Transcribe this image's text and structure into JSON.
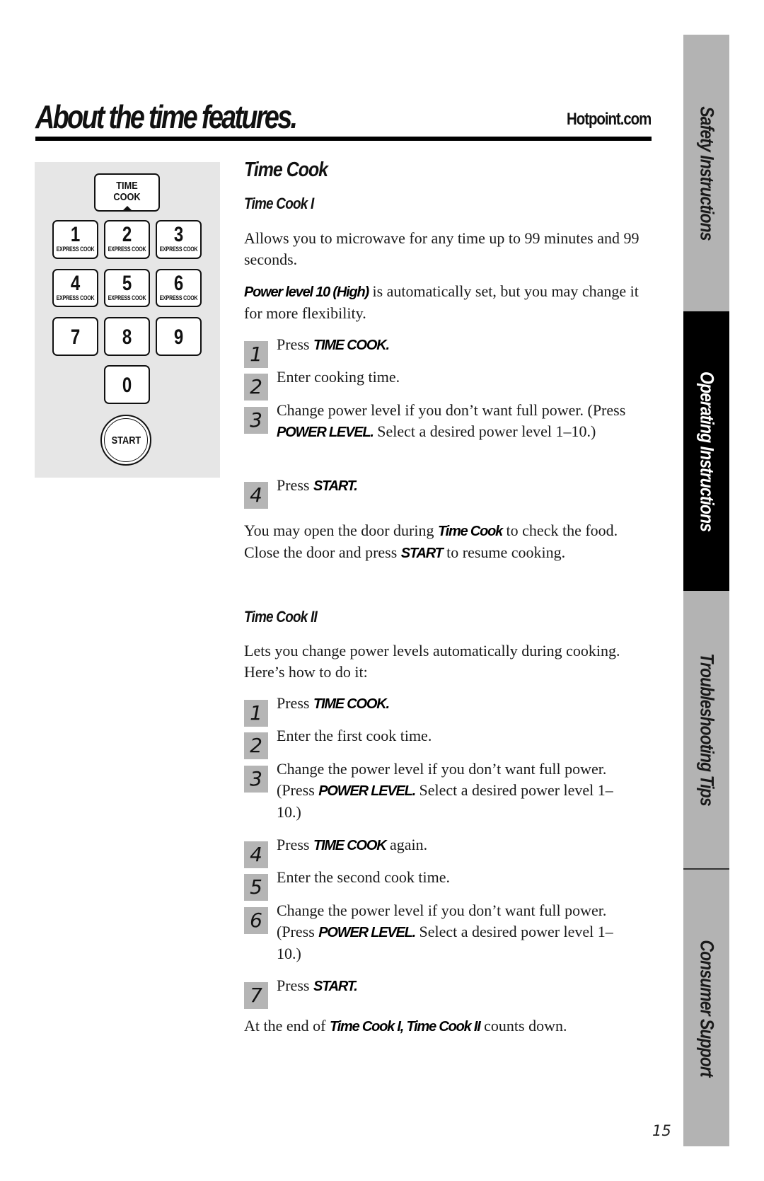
{
  "header": {
    "title": "About the time features.",
    "site": "Hotpoint.com"
  },
  "keypad": {
    "time_cook_key": [
      "TIME",
      "COOK"
    ],
    "number_keys": [
      {
        "digit": "1",
        "sub": "EXPRESS COOK"
      },
      {
        "digit": "2",
        "sub": "EXPRESS COOK"
      },
      {
        "digit": "3",
        "sub": "EXPRESS COOK"
      },
      {
        "digit": "4",
        "sub": "EXPRESS COOK"
      },
      {
        "digit": "5",
        "sub": "EXPRESS COOK"
      },
      {
        "digit": "6",
        "sub": "EXPRESS COOK"
      },
      {
        "digit": "7",
        "sub": ""
      },
      {
        "digit": "8",
        "sub": ""
      },
      {
        "digit": "9",
        "sub": ""
      },
      {
        "digit": "0",
        "sub": ""
      }
    ],
    "start_key": "START"
  },
  "content": {
    "section_title": "Time Cook",
    "time_cook_1": {
      "heading": "Time Cook I",
      "intro": "Allows you to microwave for any time up to 99 minutes and 99 seconds.",
      "power_note_em": "Power level 10 (High)",
      "power_note_rest": " is automatically set, but you may change it for more flexibility.",
      "steps": [
        {
          "n": "1",
          "parts": [
            {
              "t": "Press "
            },
            {
              "em": "TIME COOK."
            }
          ]
        },
        {
          "n": "2",
          "parts": [
            {
              "t": "Enter cooking time."
            }
          ]
        },
        {
          "n": "3",
          "parts": [
            {
              "t": "Change power level if you don’t want full power. (Press "
            },
            {
              "em": "POWER LEVEL."
            },
            {
              "t": " Select a desired power level 1–10.)"
            }
          ]
        },
        {
          "n": "4",
          "parts": [
            {
              "t": "Press "
            },
            {
              "em": "START."
            }
          ]
        }
      ],
      "door_note": [
        {
          "t": "You may open the door during "
        },
        {
          "em": "Time Cook"
        },
        {
          "t": " to check the food. Close the door and press "
        },
        {
          "em": "START"
        },
        {
          "t": " to resume cooking."
        }
      ]
    },
    "time_cook_2": {
      "heading": "Time Cook II",
      "intro": "Lets you change power levels automatically during cooking. Here’s how to do it:",
      "steps": [
        {
          "n": "1",
          "parts": [
            {
              "t": "Press "
            },
            {
              "em": "TIME COOK."
            }
          ]
        },
        {
          "n": "2",
          "parts": [
            {
              "t": "Enter the first cook time."
            }
          ]
        },
        {
          "n": "3",
          "parts": [
            {
              "t": "Change the power level if you don’t want full power. (Press "
            },
            {
              "em": "POWER LEVEL."
            },
            {
              "t": " Select a desired power level 1–10.)"
            }
          ]
        },
        {
          "n": "4",
          "parts": [
            {
              "t": "Press "
            },
            {
              "em": "TIME COOK"
            },
            {
              "t": " again."
            }
          ]
        },
        {
          "n": "5",
          "parts": [
            {
              "t": "Enter the second cook time."
            }
          ]
        },
        {
          "n": "6",
          "parts": [
            {
              "t": "Change the power level if you don’t want full power. (Press "
            },
            {
              "em": "POWER LEVEL."
            },
            {
              "t": " Select a desired power level 1–10.)"
            }
          ]
        },
        {
          "n": "7",
          "parts": [
            {
              "t": "Press "
            },
            {
              "em": "START."
            }
          ]
        }
      ],
      "end_note": [
        {
          "t": "At the end of "
        },
        {
          "em": "Time Cook I, Time Cook II"
        },
        {
          "t": " counts down."
        }
      ]
    }
  },
  "sidebar": {
    "tabs": [
      {
        "label": "Safety Instructions",
        "active": false
      },
      {
        "label": "Operating Instructions",
        "active": true
      },
      {
        "label": "Troubleshooting Tips",
        "active": false
      },
      {
        "label": "Consumer Support",
        "active": false
      }
    ]
  },
  "footer": {
    "page_number": "15"
  }
}
